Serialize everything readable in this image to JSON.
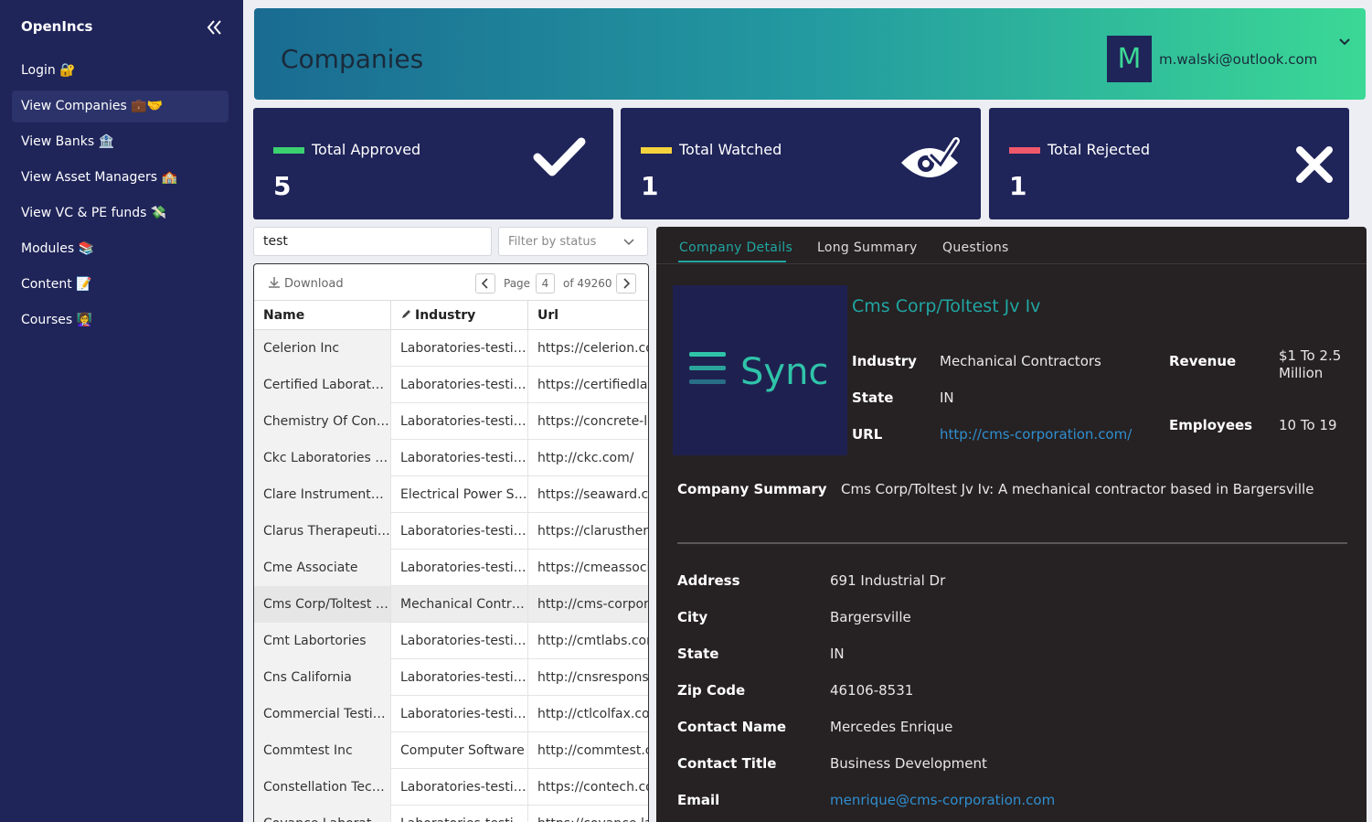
{
  "sidebar": {
    "brand": "OpenIncs",
    "items": [
      {
        "label": "Login 🔐"
      },
      {
        "label": "View Companies 💼🤝"
      },
      {
        "label": "View Banks 🏦"
      },
      {
        "label": "View Asset Managers 🏫"
      },
      {
        "label": "View VC & PE funds 💸"
      },
      {
        "label": "Modules 📚"
      },
      {
        "label": "Content 📝"
      },
      {
        "label": "Courses 👩‍🏫"
      }
    ],
    "active_index": 1
  },
  "header": {
    "title": "Companies",
    "avatar_letter": "M",
    "user_email": "m.walski@outlook.com"
  },
  "stats": {
    "approved": {
      "label": "Total Approved",
      "value": "5",
      "color": "#3bd170"
    },
    "watched": {
      "label": "Total Watched",
      "value": "1",
      "color": "#f5d33c"
    },
    "rejected": {
      "label": "Total Rejected",
      "value": "1",
      "color": "#f0596b"
    }
  },
  "search": {
    "value": "test"
  },
  "filter": {
    "placeholder": "Filter by status"
  },
  "table": {
    "download_label": "Download",
    "page_label": "Page",
    "page": "4",
    "of_label": "of 49260",
    "columns": [
      "Name",
      "Industry",
      "Url"
    ],
    "rows": [
      {
        "name": "Celerion Inc",
        "industry": "Laboratories-testing",
        "url": "https://celerion.com/"
      },
      {
        "name": "Certified Laboratori...",
        "industry": "Laboratories-testing",
        "url": "https://certifiedlabs.c"
      },
      {
        "name": "Chemistry Of Conc...",
        "industry": "Laboratories-testing",
        "url": "https://concrete-la..."
      },
      {
        "name": "Ckc Laboratories Inc",
        "industry": "Laboratories-testing",
        "url": "http://ckc.com/"
      },
      {
        "name": "Clare Instruments I...",
        "industry": "Electrical Power Sy...",
        "url": "https://seaward.co..."
      },
      {
        "name": "Clarus Therapeutics",
        "industry": "Laboratories-testing",
        "url": "https://clarustherap..."
      },
      {
        "name": "Cme Associate",
        "industry": "Laboratories-testing",
        "url": "https://cmeassociat..."
      },
      {
        "name": "Cms Corp/Toltest J...",
        "industry": "Mechanical Contra...",
        "url": "http://cms-corporat..."
      },
      {
        "name": "Cmt Labortories",
        "industry": "Laboratories-testing",
        "url": "http://cmtlabs.com/"
      },
      {
        "name": "Cns California",
        "industry": "Laboratories-testing",
        "url": "http://cnsresponse..."
      },
      {
        "name": "Commercial Testin...",
        "industry": "Laboratories-testing",
        "url": "http://ctlcolfax.com/"
      },
      {
        "name": "Commtest Inc",
        "industry": "Computer Software",
        "url": "http://commtest.co..."
      },
      {
        "name": "Constellation Tech...",
        "industry": "Laboratories-testing",
        "url": "https://contech.com/"
      },
      {
        "name": "Covance Laborat...",
        "industry": "Laboratories-testing",
        "url": "https://covance.la..."
      }
    ],
    "selected_index": 7
  },
  "details": {
    "tabs": [
      "Company Details",
      "Long Summary",
      "Questions"
    ],
    "logo_text": "Sync",
    "company_name": "Cms Corp/Toltest Jv Iv",
    "fields": {
      "industry_label": "Industry",
      "industry": "Mechanical Contractors",
      "state_label": "State",
      "state": "IN",
      "url_label": "URL",
      "url": "http://cms-corporation.com/",
      "revenue_label": "Revenue",
      "revenue": "$1 To 2.5 Million",
      "employees_label": "Employees",
      "employees": "10 To 19"
    },
    "summary_label": "Company Summary",
    "summary": "Cms Corp/Toltest Jv Iv: A mechanical contractor based in Bargersville",
    "contact": {
      "address_label": "Address",
      "address": "691 Industrial Dr",
      "city_label": "City",
      "city": "Bargersville",
      "state_label": "State",
      "state": "IN",
      "zip_label": "Zip Code",
      "zip": "46106-8531",
      "name_label": "Contact Name",
      "name": "Mercedes Enrique",
      "title_label": "Contact Title",
      "title": "Business Development",
      "email_label": "Email",
      "email": "menrique@cms-corporation.com"
    }
  },
  "colors": {
    "sidebar": "#1f2459",
    "accent": "#20a6a3",
    "link": "#2f8fd0",
    "panel": "#262122"
  }
}
